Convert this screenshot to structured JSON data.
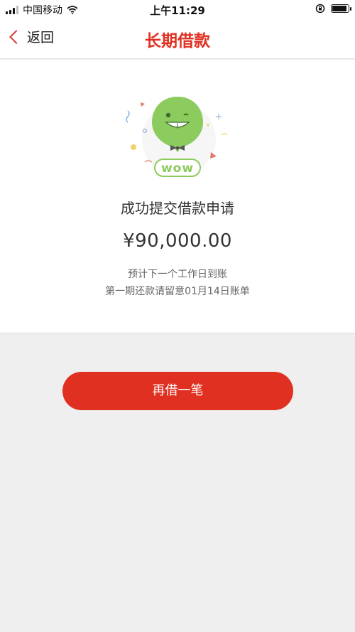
{
  "status_bar": {
    "carrier": "中国移动",
    "time": "上午11:29"
  },
  "nav": {
    "back_label": "返回",
    "title": "长期借款"
  },
  "result": {
    "illustration_text": "wow",
    "title": "成功提交借款申请",
    "amount": "¥90,000.00",
    "note_arrival": "预计下一个工作日到账",
    "note_repayment": "第一期还款请留意01月14日账单"
  },
  "actions": {
    "borrow_again_label": "再借一笔"
  },
  "colors": {
    "brand_red": "#e03021",
    "balloon_green": "#8ccb5e",
    "background": "#efefef"
  }
}
